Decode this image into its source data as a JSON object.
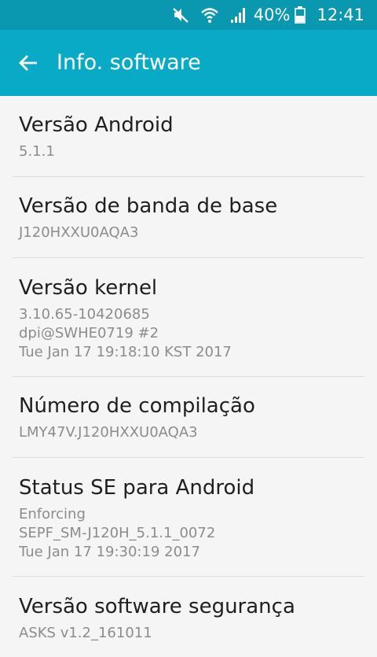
{
  "status_bar": {
    "icons": [
      "mute-icon",
      "wifi-icon",
      "signal-icon",
      "battery-icon"
    ],
    "battery": "40%",
    "time": "12:41"
  },
  "app_bar": {
    "title": "Info. software",
    "back_icon": "arrow-back-icon"
  },
  "colors": {
    "status_bar": "#0a97b0",
    "app_bar": "#08aac6",
    "background": "#f5f5f5",
    "title_text": "#1f1f1f",
    "value_text": "#8c8c8c",
    "divider": "#dcdcdc"
  },
  "items": [
    {
      "title": "Versão Android",
      "lines": [
        "5.1.1"
      ]
    },
    {
      "title": "Versão de banda de base",
      "lines": [
        "J120HXXU0AQA3"
      ]
    },
    {
      "title": "Versão kernel",
      "lines": [
        "3.10.65-10420685",
        "dpi@SWHE0719 #2",
        "Tue Jan 17 19:18:10 KST 2017"
      ]
    },
    {
      "title": "Número de compilação",
      "lines": [
        "LMY47V.J120HXXU0AQA3"
      ]
    },
    {
      "title": "Status SE para Android",
      "lines": [
        "Enforcing",
        "SEPF_SM-J120H_5.1.1_0072",
        "Tue Jan 17 19:30:19 2017"
      ]
    },
    {
      "title": "Versão software segurança",
      "lines": [
        "ASKS v1.2_161011"
      ]
    }
  ]
}
